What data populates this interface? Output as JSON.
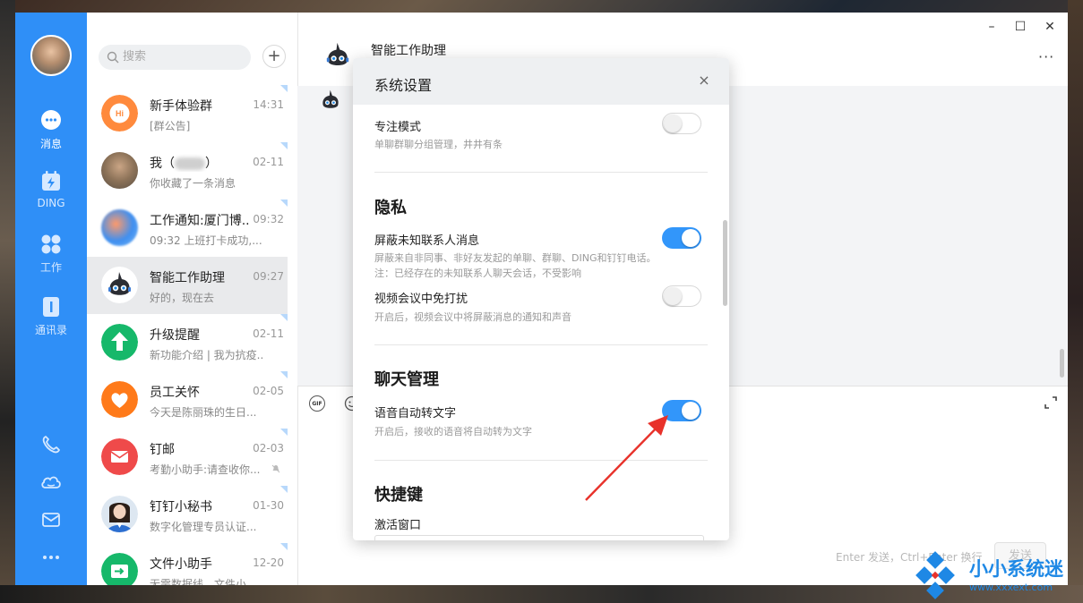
{
  "search": {
    "placeholder": "搜索"
  },
  "nav": {
    "items": [
      {
        "label": "消息",
        "icon": "message-icon"
      },
      {
        "label": "DING",
        "icon": "ding-icon"
      },
      {
        "label": "工作",
        "icon": "work-grid-icon"
      },
      {
        "label": "通讯录",
        "icon": "contacts-icon"
      }
    ],
    "bottom_icons": [
      "phone-icon",
      "cloud-icon",
      "mail-icon",
      "more-dots-icon"
    ]
  },
  "conversations": [
    {
      "name": "新手体验群",
      "time": "14:31",
      "preview": "[群公告]"
    },
    {
      "name": "我（",
      "name_suffix": "）",
      "time": "02-11",
      "preview": "你收藏了一条消息"
    },
    {
      "name": "工作通知:厦门博...",
      "time": "09:32",
      "preview": "09:32 上班打卡成功,..."
    },
    {
      "name": "智能工作助理",
      "time": "09:27",
      "preview": "好的，现在去"
    },
    {
      "name": "升级提醒",
      "time": "02-11",
      "preview": "新功能介绍 | 我为抗疫..."
    },
    {
      "name": "员工关怀",
      "time": "02-05",
      "preview": "今天是陈丽珠的生日..."
    },
    {
      "name": "钉邮",
      "time": "02-03",
      "preview": "考勤小助手:请查收你..."
    },
    {
      "name": "钉钉小秘书",
      "time": "01-30",
      "preview": "数字化管理专员认证..."
    },
    {
      "name": "文件小助手",
      "time": "12-20",
      "preview": "无需数据线，文件小..."
    }
  ],
  "chat": {
    "title": "智能工作助理",
    "send_hint": "Enter 发送，Ctrl+Enter 换行",
    "send_label": "发送",
    "gif_label": "GIF"
  },
  "window": {
    "minimize": "–",
    "maximize": "☐",
    "close": "✕",
    "more": "···"
  },
  "settings": {
    "title": "系统设置",
    "close": "×",
    "focus_mode": {
      "label": "专注模式",
      "desc": "单聊群聊分组管理，井井有条",
      "enabled": false
    },
    "privacy": {
      "heading": "隐私",
      "block_unknown": {
        "label": "屏蔽未知联系人消息",
        "desc": "屏蔽来自非同事、非好友发起的单聊、群聊、DING和钉钉电话。注：已经存在的未知联系人聊天会话，不受影响",
        "enabled": true
      },
      "video_dnd": {
        "label": "视频会议中免打扰",
        "desc": "开启后，视频会议中将屏蔽消息的通知和声音",
        "enabled": false
      }
    },
    "chat_mgmt": {
      "heading": "聊天管理",
      "voice_to_text": {
        "label": "语音自动转文字",
        "desc": "开启后，接收的语音将自动转为文字",
        "enabled": true
      }
    },
    "shortcuts": {
      "heading": "快捷键",
      "activate_window": "激活窗口"
    }
  },
  "watermark": {
    "text": "小小系统迷",
    "url": "www.xxxext.com"
  },
  "colors": {
    "nav_blue": "#2f8ff7",
    "toggle_on": "#3296fa",
    "annotation_red": "#e8322b"
  }
}
